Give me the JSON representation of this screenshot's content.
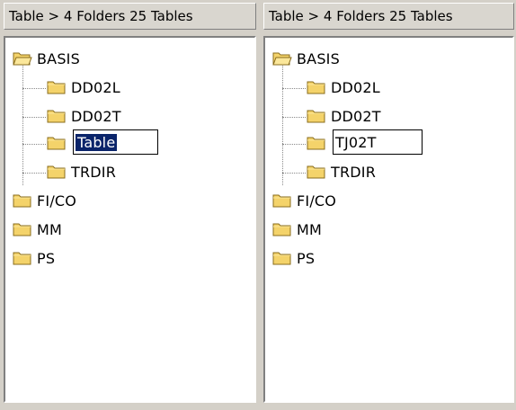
{
  "icons": {
    "folder": "folder-icon"
  },
  "colors": {
    "selection": "#0a246a",
    "folder_fill": "#f4d36a",
    "folder_stroke": "#8a6d1d"
  },
  "left_panel": {
    "header": "Table > 4 Folders 25 Tables",
    "items": {
      "basis": "BASIS",
      "dd02l": "DD02L",
      "dd02t": "DD02T",
      "edit": "Table",
      "trdir": "TRDIR",
      "fico": "FI/CO",
      "mm": "MM",
      "ps": "PS"
    }
  },
  "right_panel": {
    "header": "Table > 4 Folders 25 Tables",
    "items": {
      "basis": "BASIS",
      "dd02l": "DD02L",
      "dd02t": "DD02T",
      "edit": "TJ02T",
      "trdir": "TRDIR",
      "fico": "FI/CO",
      "mm": "MM",
      "ps": "PS"
    }
  }
}
